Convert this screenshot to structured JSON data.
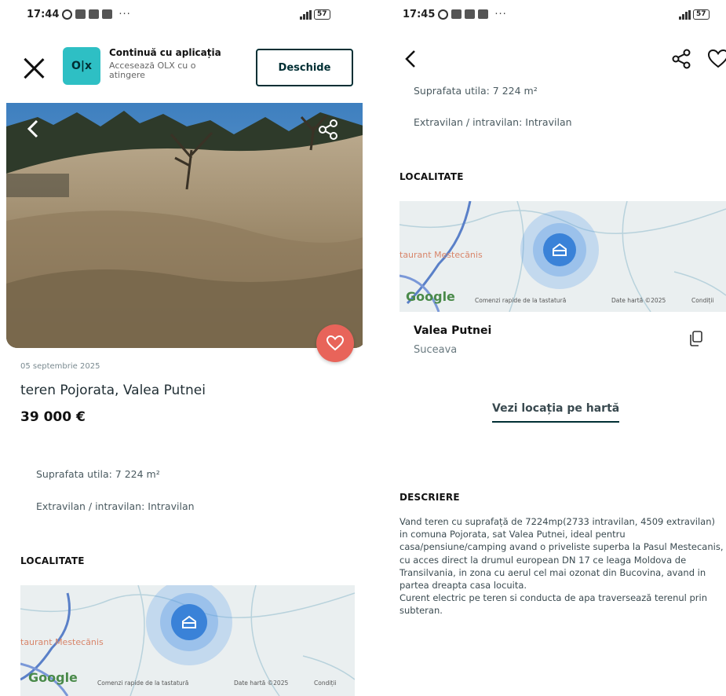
{
  "left": {
    "status": {
      "time": "17:44",
      "battery": "57"
    },
    "banner": {
      "title": "Continuă cu aplicația",
      "subtitle": "Accesează OLX cu o atingere",
      "open_label": "Deschide",
      "logo_text": "O|x"
    },
    "listing": {
      "date": "05 septembrie 2025",
      "title": "teren Pojorata, Valea Putnei",
      "price": "39 000 €",
      "params": [
        "Suprafata utila: 7 224 m²",
        "Extravilan / intravilan: Intravilan"
      ]
    },
    "location_heading": "LOCALITATE",
    "map": {
      "place": "taurant Mestecănis",
      "google": "Google",
      "shortcuts": "Comenzi rapide de la tastatură",
      "map_data": "Date hartă ©2025",
      "terms": "Condiții"
    }
  },
  "right": {
    "status": {
      "time": "17:45",
      "battery": "57"
    },
    "params": [
      "Suprafata utila: 7 224 m²",
      "Extravilan / intravilan: Intravilan"
    ],
    "location_heading": "LOCALITATE",
    "map": {
      "place": "taurant Mestecănis",
      "google": "Google",
      "shortcuts": "Comenzi rapide de la tastatură",
      "map_data": "Date hartă ©2025",
      "terms": "Condiții"
    },
    "location": {
      "name": "Valea Putnei",
      "county": "Suceava"
    },
    "map_link": "Vezi locația pe hartă",
    "description_heading": "DESCRIERE",
    "description": [
      "Vand teren cu suprafață de 7224mp(2733 intravilan, 4509 extravilan) in comuna Pojorata, sat Valea Putnei, ideal pentru casa/pensiune/camping avand o priveliste superba la Pasul Mestecanis, cu acces direct la drumul european DN 17 ce leaga Moldova de Transilvania, in zona cu aerul cel mai ozonat din Bucovina, avand in partea dreapta casa locuita.",
      "Curent electric pe teren si conducta de apa traversează terenul prin subteran."
    ]
  },
  "colors": {
    "brand_dark": "#002f34",
    "olx_teal": "#2ebfc4",
    "favorite": "#e8645a",
    "map_pin": "#3a82d8"
  },
  "icons": [
    "close-icon",
    "share-icon",
    "heart-icon",
    "back-icon",
    "copy-icon",
    "alarm-icon"
  ]
}
